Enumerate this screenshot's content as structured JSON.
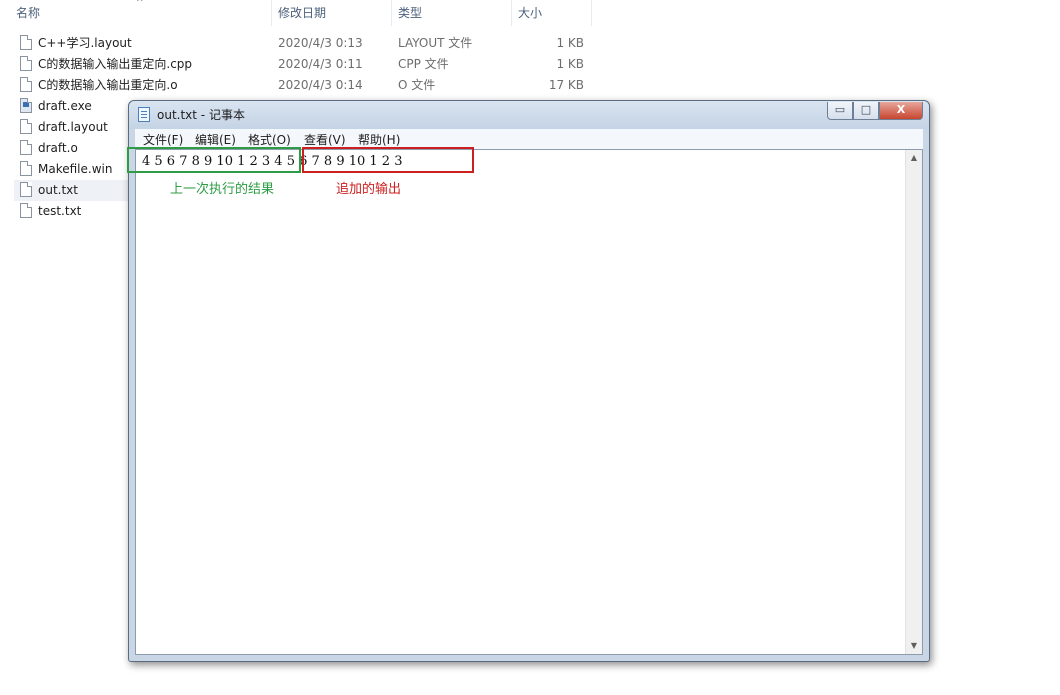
{
  "explorer": {
    "columns": {
      "name": "名称",
      "modified": "修改日期",
      "type": "类型",
      "size": "大小"
    },
    "files": [
      {
        "name": "C++学习.layout",
        "modified": "2020/4/3 0:13",
        "type": "LAYOUT 文件",
        "size": "1 KB",
        "icon": "file-icon"
      },
      {
        "name": "C的数据输入输出重定向.cpp",
        "modified": "2020/4/3 0:11",
        "type": "CPP 文件",
        "size": "1 KB",
        "icon": "file-icon"
      },
      {
        "name": "C的数据输入输出重定向.o",
        "modified": "2020/4/3 0:14",
        "type": "O 文件",
        "size": "17 KB",
        "icon": "file-icon"
      },
      {
        "name": "draft.exe",
        "icon": "exe-icon"
      },
      {
        "name": "draft.layout",
        "icon": "file-icon"
      },
      {
        "name": "draft.o",
        "icon": "file-icon"
      },
      {
        "name": "Makefile.win",
        "icon": "file-icon"
      },
      {
        "name": "out.txt",
        "icon": "text-file-icon",
        "selected": true
      },
      {
        "name": "test.txt",
        "icon": "text-file-icon"
      }
    ]
  },
  "notepad": {
    "title": "out.txt - 记事本",
    "menu": [
      "文件(F)",
      "编辑(E)",
      "格式(O)",
      "查看(V)",
      "帮助(H)"
    ],
    "content": "4 5 6 7 8 9 10 1 2 3 4 5 6 7 8 9 10 1 2 3",
    "window_buttons": {
      "minimize": "▭",
      "maximize": "□",
      "close": "X"
    }
  },
  "annotations": {
    "previous_result": "上一次执行的结果",
    "appended_output": "追加的输出",
    "colors": {
      "previous": "#2e9c45",
      "appended": "#cc2020"
    }
  }
}
